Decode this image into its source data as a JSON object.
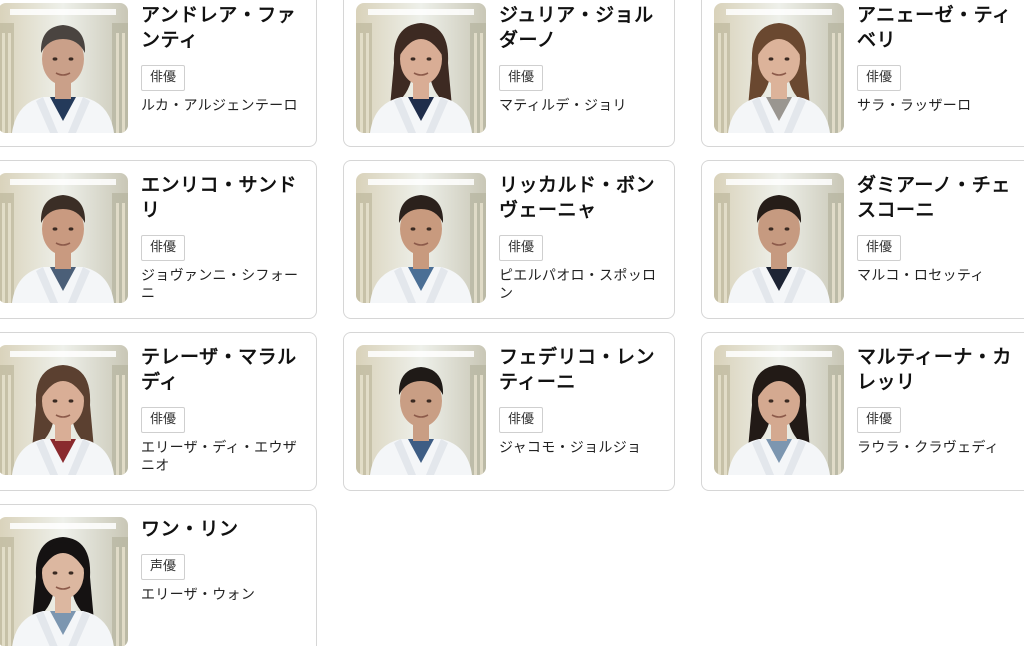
{
  "cast": [
    {
      "character": "アンドレア・ファンティ",
      "role": "俳優",
      "actor": "ルカ・アルジェンテーロ",
      "photo": "male-doctor-portrait",
      "skin": "#caa089",
      "hair": "#4a4440",
      "shirt": "#243a5a"
    },
    {
      "character": "ジュリア・ジョルダーノ",
      "role": "俳優",
      "actor": "マティルデ・ジョリ",
      "photo": "female-doctor-portrait",
      "skin": "#d9ad95",
      "hair": "#3d2a22",
      "shirt": "#1f2d4a"
    },
    {
      "character": "アニェーゼ・ティベリ",
      "role": "俳優",
      "actor": "サラ・ラッザーロ",
      "photo": "female-doctor-portrait",
      "skin": "#dcb39a",
      "hair": "#6a4830",
      "shirt": "#9a9690"
    },
    {
      "character": "エンリコ・サンドリ",
      "role": "俳優",
      "actor": "ジョヴァンニ・シフォーニ",
      "photo": "male-doctor-portrait",
      "skin": "#c99a80",
      "hair": "#3b2e26",
      "shirt": "#4b5f78"
    },
    {
      "character": "リッカルド・ボンヴェーニャ",
      "role": "俳優",
      "actor": "ピエルパオロ・スポッロン",
      "photo": "male-doctor-portrait",
      "skin": "#c89a7e",
      "hair": "#2b211c",
      "shirt": "#4b6f95"
    },
    {
      "character": "ダミアーノ・チェスコーニ",
      "role": "俳優",
      "actor": "マルコ・ロセッティ",
      "photo": "male-doctor-portrait",
      "skin": "#c69a80",
      "hair": "#261d18",
      "shirt": "#1d2434"
    },
    {
      "character": "テレーザ・マラルディ",
      "role": "俳優",
      "actor": "エリーザ・ディ・エウザニオ",
      "photo": "female-doctor-portrait",
      "skin": "#d9ae96",
      "hair": "#5b4030",
      "shirt": "#8a2a2e"
    },
    {
      "character": "フェデリコ・レンティーニ",
      "role": "俳優",
      "actor": "ジャコモ・ジョルジョ",
      "photo": "male-doctor-portrait",
      "skin": "#c99e84",
      "hair": "#1f1a17",
      "shirt": "#3e5d84"
    },
    {
      "character": "マルティーナ・カレッリ",
      "role": "俳優",
      "actor": "ラウラ・クラヴェディ",
      "photo": "female-doctor-portrait",
      "skin": "#d4a990",
      "hair": "#221a16",
      "shirt": "#7c96b0"
    },
    {
      "character": "ワン・リン",
      "role": "声優",
      "actor": "エリーザ・ウォン",
      "photo": "female-doctor-portrait",
      "skin": "#dcb7a0",
      "hair": "#151212",
      "shirt": "#7c96b0"
    }
  ]
}
